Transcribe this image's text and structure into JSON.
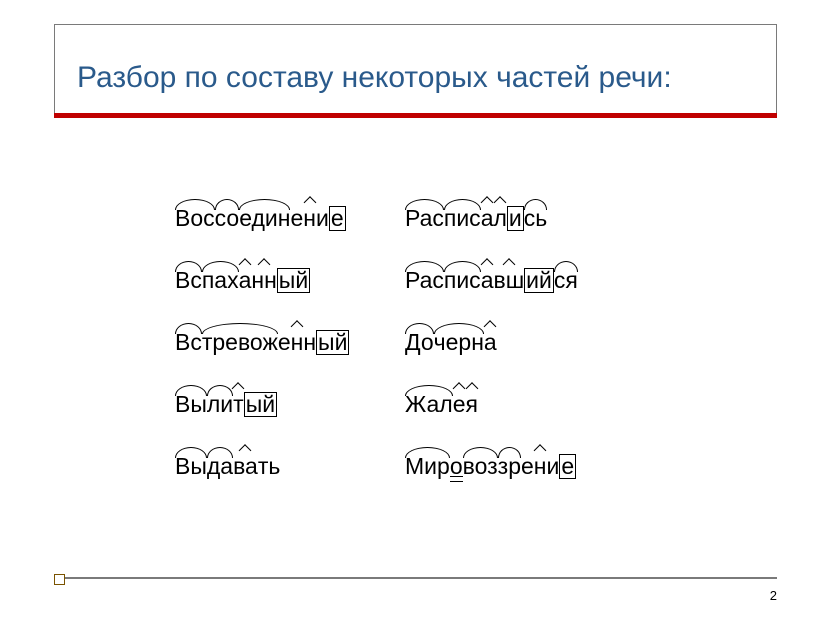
{
  "slide": {
    "title": "Разбор по составу некоторых частей речи:",
    "page_number": "2"
  },
  "words": {
    "col1": [
      {
        "segments": [
          {
            "t": "Вос",
            "style": "arc"
          },
          {
            "t": "со",
            "style": "arc"
          },
          {
            "t": "един",
            "style": "arc"
          },
          {
            "t": "ени",
            "style": "caret"
          },
          {
            "t": "е",
            "style": "boxed"
          }
        ]
      },
      {
        "segments": [
          {
            "t": "Вс",
            "style": "arc"
          },
          {
            "t": "пах",
            "style": "arc"
          },
          {
            "t": "а",
            "style": "caret"
          },
          {
            "t": "нн",
            "style": "caret"
          },
          {
            "t": "ый",
            "style": "boxed"
          }
        ]
      },
      {
        "segments": [
          {
            "t": "Вс",
            "style": "arc"
          },
          {
            "t": "тревож",
            "style": "arc"
          },
          {
            "t": "енн",
            "style": "caret"
          },
          {
            "t": "ый",
            "style": "boxed"
          }
        ]
      },
      {
        "segments": [
          {
            "t": "Вы",
            "style": "arc"
          },
          {
            "t": "ли",
            "style": "arc"
          },
          {
            "t": "т",
            "style": "caret"
          },
          {
            "t": "ый",
            "style": "boxed"
          }
        ]
      },
      {
        "segments": [
          {
            "t": "Вы",
            "style": "arc"
          },
          {
            "t": "да",
            "style": "arc"
          },
          {
            "t": "ва",
            "style": "caret"
          },
          {
            "t": "ть",
            "style": ""
          }
        ]
      }
    ],
    "col2": [
      {
        "segments": [
          {
            "t": "Рас",
            "style": "arc"
          },
          {
            "t": "пис",
            "style": "arc"
          },
          {
            "t": "а",
            "style": "caret"
          },
          {
            "t": "л",
            "style": "caret"
          },
          {
            "t": "и",
            "style": "boxed"
          },
          {
            "t": "сь",
            "style": "arc"
          }
        ]
      },
      {
        "segments": [
          {
            "t": "Рас",
            "style": "arc"
          },
          {
            "t": "пис",
            "style": "arc"
          },
          {
            "t": "а",
            "style": "caret"
          },
          {
            "t": "вш",
            "style": "caret"
          },
          {
            "t": "ий",
            "style": "boxed"
          },
          {
            "t": "ся",
            "style": "arc"
          }
        ]
      },
      {
        "segments": [
          {
            "t": "До",
            "style": "arc"
          },
          {
            "t": "черн",
            "style": "arc"
          },
          {
            "t": "а",
            "style": "caret"
          }
        ]
      },
      {
        "segments": [
          {
            "t": "Жал",
            "style": "arc"
          },
          {
            "t": "е",
            "style": "caret"
          },
          {
            "t": "я",
            "style": "caret"
          }
        ]
      },
      {
        "segments": [
          {
            "t": "Мир",
            "style": "arc"
          },
          {
            "t": "о",
            "style": "dblul"
          },
          {
            "t": "воз",
            "style": "arc"
          },
          {
            "t": "зр",
            "style": "arc"
          },
          {
            "t": "ени",
            "style": "caret"
          },
          {
            "t": "е",
            "style": "boxed"
          }
        ]
      }
    ]
  }
}
